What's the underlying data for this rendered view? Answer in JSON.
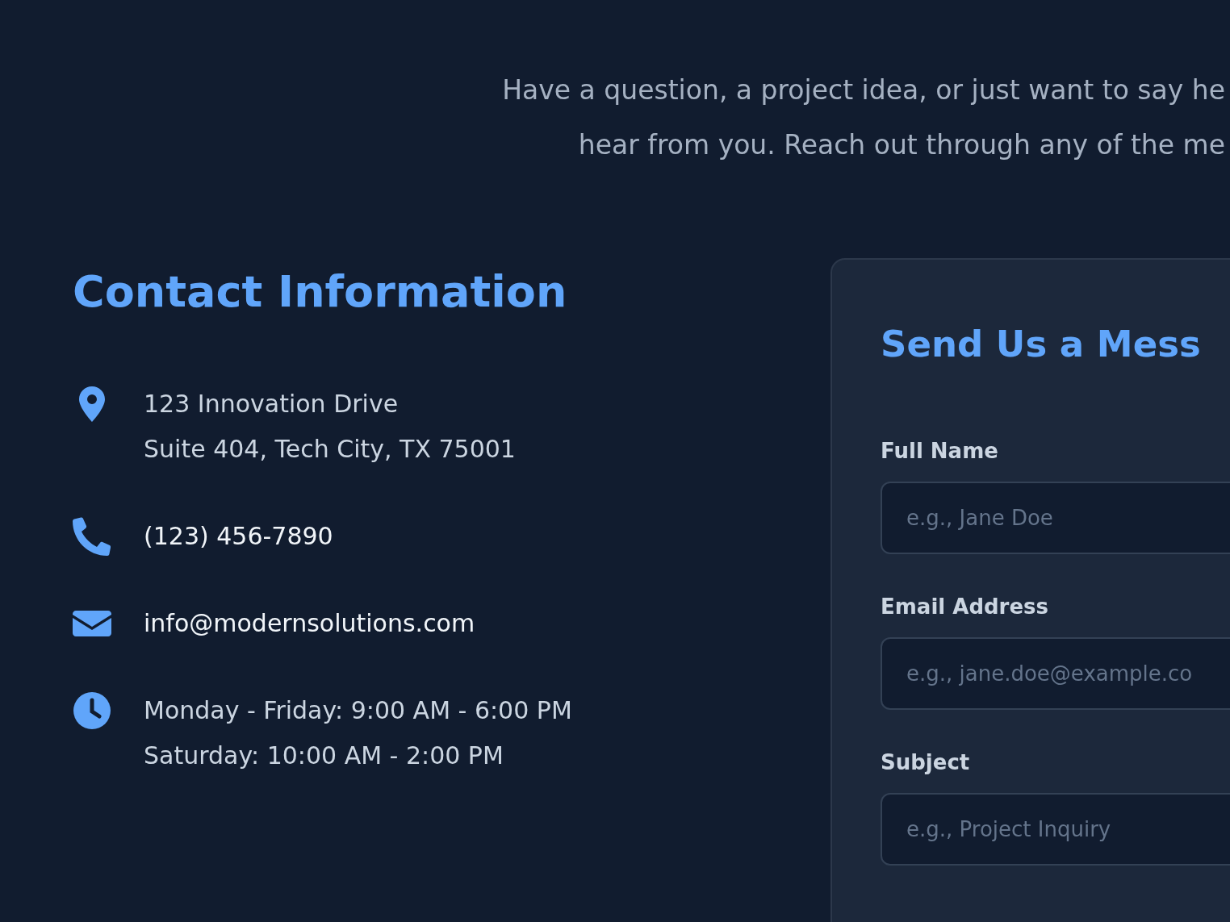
{
  "intro": {
    "lines": [
      "Have a question, a project idea, or just want to say he",
      "hear from you. Reach out through any of the me"
    ]
  },
  "contact_info": {
    "title": "Contact Information",
    "items": [
      {
        "kind": "address",
        "lines": [
          "123 Innovation Drive",
          "Suite 404, Tech City, TX 75001"
        ]
      },
      {
        "kind": "phone",
        "lines": [
          "(123) 456-7890"
        ]
      },
      {
        "kind": "email",
        "lines": [
          "info@modernsolutions.com"
        ]
      },
      {
        "kind": "hours",
        "lines": [
          "Monday - Friday: 9:00 AM - 6:00 PM",
          "Saturday: 10:00 AM - 2:00 PM"
        ]
      }
    ]
  },
  "form": {
    "title": "Send Us a Mess",
    "fields": [
      {
        "label": "Full Name",
        "placeholder": "e.g., Jane Doe"
      },
      {
        "label": "Email Address",
        "placeholder": "e.g., jane.doe@example.co"
      },
      {
        "label": "Subject",
        "placeholder": "e.g., Project Inquiry"
      }
    ]
  }
}
